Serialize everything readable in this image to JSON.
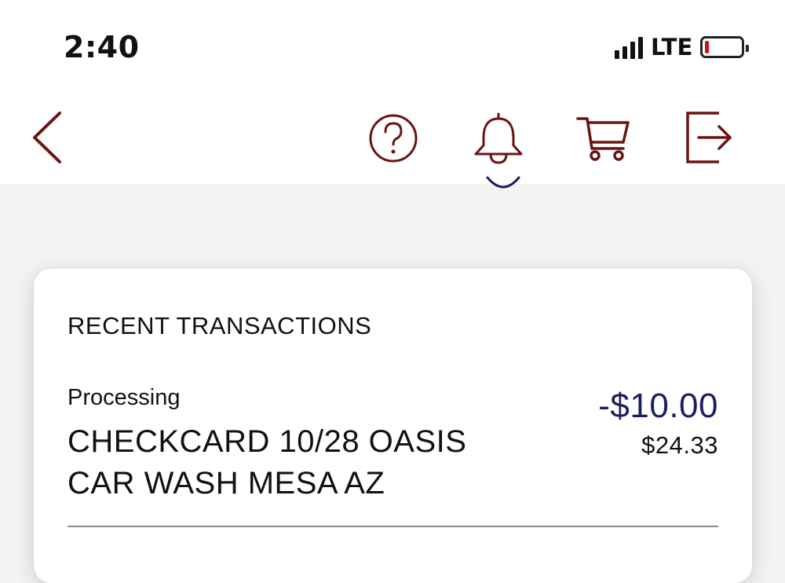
{
  "status_bar": {
    "time": "2:40",
    "network": "LTE",
    "signal_bars": 4,
    "battery_level": 0.1,
    "battery_color": "#c8102e"
  },
  "toolbar": {
    "accent_color": "#6b1414",
    "icons": [
      "back-chevron-icon",
      "help-icon",
      "notifications-bell-icon",
      "cart-icon",
      "sign-out-icon"
    ]
  },
  "recent_transactions": {
    "title": "RECENT TRANSACTIONS",
    "items": [
      {
        "status": "Processing",
        "description": "CHECKCARD 10/28 OASIS CAR WASH MESA AZ",
        "amount": "-$10.00",
        "balance": "$24.33",
        "amount_color": "#1b1f5e"
      }
    ]
  }
}
